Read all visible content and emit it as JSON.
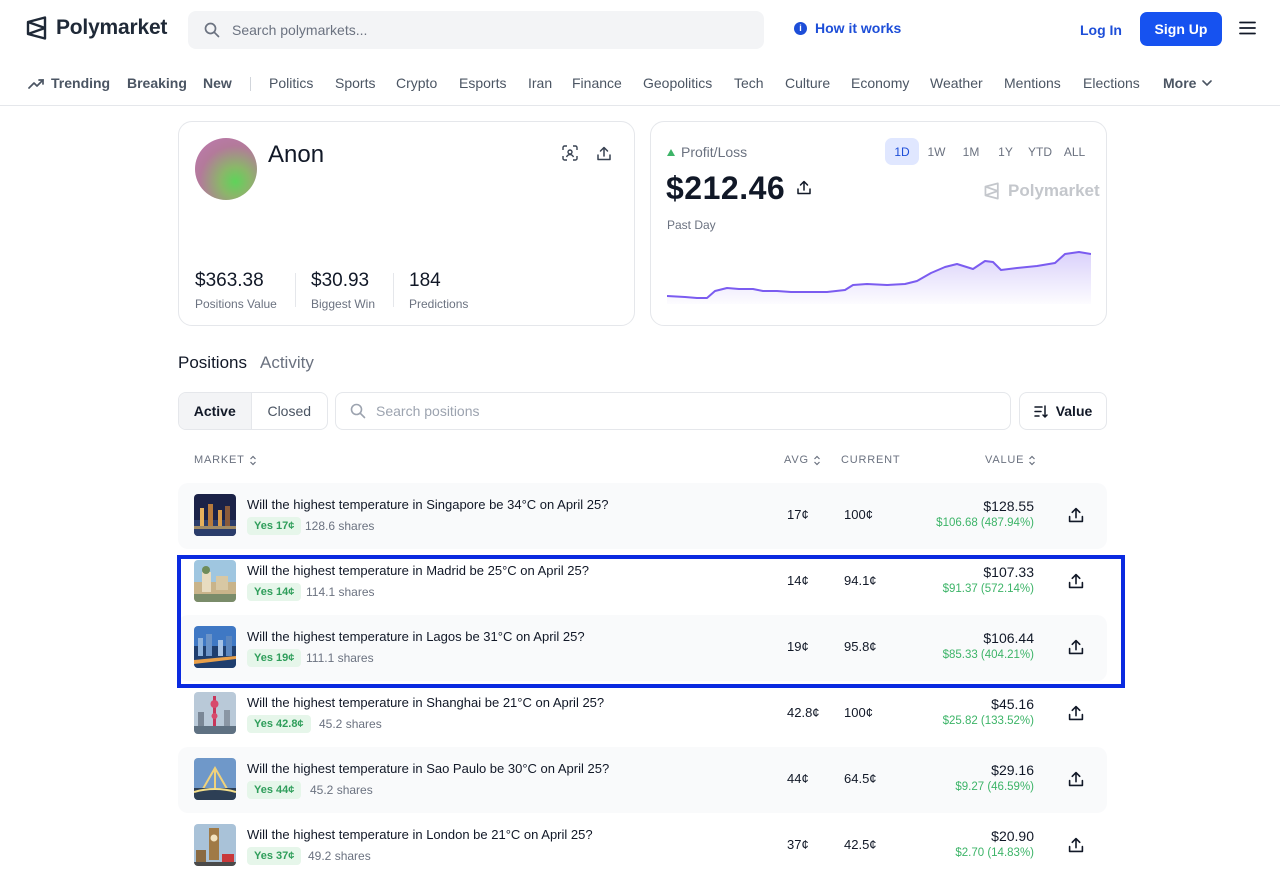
{
  "header": {
    "brand": "Polymarket",
    "search_placeholder": "Search polymarkets...",
    "how_it_works": "How it works",
    "login": "Log In",
    "signup": "Sign Up"
  },
  "categories": [
    "Trending",
    "Breaking",
    "New",
    "Politics",
    "Sports",
    "Crypto",
    "Esports",
    "Iran",
    "Finance",
    "Geopolitics",
    "Tech",
    "Culture",
    "Economy",
    "Weather",
    "Mentions",
    "Elections",
    "More"
  ],
  "profile": {
    "name": "Anon",
    "positions_value": "$363.38",
    "positions_value_label": "Positions Value",
    "biggest_win": "$30.93",
    "biggest_win_label": "Biggest Win",
    "predictions": "184",
    "predictions_label": "Predictions"
  },
  "pnl": {
    "label": "Profit/Loss",
    "value": "$212.46",
    "period": "Past Day",
    "watermark": "Polymarket",
    "ranges": [
      "1D",
      "1W",
      "1M",
      "1Y",
      "YTD",
      "ALL"
    ],
    "active_range": "1D",
    "colors": {
      "line": "#7b5cf0",
      "up": "#3db468"
    }
  },
  "tabs": {
    "positions": "Positions",
    "activity": "Activity"
  },
  "filters": {
    "active": "Active",
    "closed": "Closed",
    "search_placeholder": "Search positions",
    "sort": "Value"
  },
  "table": {
    "headers": {
      "market": "MARKET",
      "avg": "AVG",
      "current": "CURRENT",
      "value": "VALUE"
    },
    "rows": [
      {
        "title": "Will the highest temperature in Singapore be 34°C on April 25?",
        "outcome": "Yes 17¢",
        "shares": "128.6 shares",
        "avg": "17¢",
        "current": "100¢",
        "value": "$128.55",
        "pnl": "$106.68 (487.94%)"
      },
      {
        "title": "Will the highest temperature in Madrid be 25°C on April 25?",
        "outcome": "Yes 14¢",
        "shares": "114.1 shares",
        "avg": "14¢",
        "current": "94.1¢",
        "value": "$107.33",
        "pnl": "$91.37 (572.14%)"
      },
      {
        "title": "Will the highest temperature in Lagos be 31°C on April 25?",
        "outcome": "Yes 19¢",
        "shares": "111.1 shares",
        "avg": "19¢",
        "current": "95.8¢",
        "value": "$106.44",
        "pnl": "$85.33 (404.21%)"
      },
      {
        "title": "Will the highest temperature in Shanghai be 21°C on April 25?",
        "outcome": "Yes 42.8¢",
        "shares": "45.2 shares",
        "avg": "42.8¢",
        "current": "100¢",
        "value": "$45.16",
        "pnl": "$25.82 (133.52%)"
      },
      {
        "title": "Will the highest temperature in Sao Paulo be 30°C on April 25?",
        "outcome": "Yes 44¢",
        "shares": "45.2 shares",
        "avg": "44¢",
        "current": "64.5¢",
        "value": "$29.16",
        "pnl": "$9.27 (46.59%)"
      },
      {
        "title": "Will the highest temperature in London be 21°C on April 25?",
        "outcome": "Yes 37¢",
        "shares": "49.2 shares",
        "avg": "37¢",
        "current": "42.5¢",
        "value": "$20.90",
        "pnl": "$2.70 (14.83%)"
      }
    ]
  }
}
